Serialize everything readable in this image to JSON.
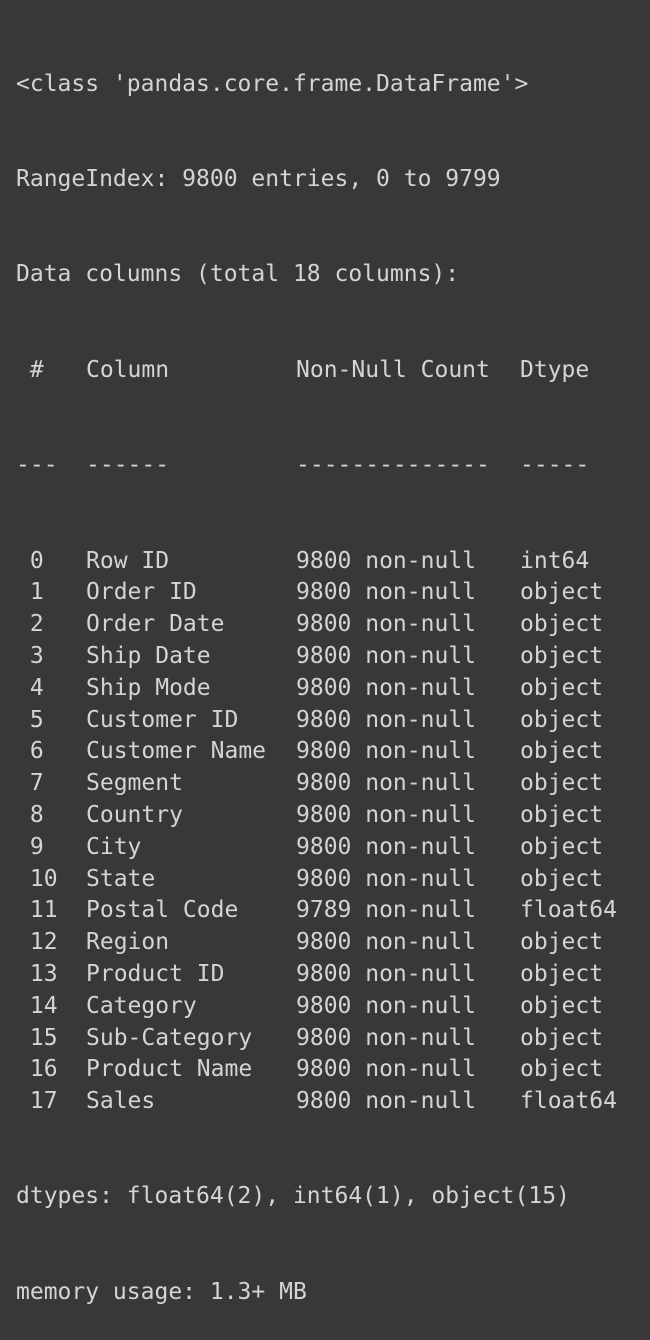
{
  "header": {
    "class_line": "<class 'pandas.core.frame.DataFrame'>",
    "range_index": "RangeIndex: 9800 entries, 0 to 9799",
    "data_columns": "Data columns (total 18 columns):"
  },
  "table": {
    "headers": {
      "idx": " #",
      "column": "Column",
      "non_null": "Non-Null Count",
      "dtype": "Dtype"
    },
    "separators": {
      "idx": "---",
      "column": "------",
      "non_null": "--------------",
      "dtype": "-----"
    },
    "rows": [
      {
        "idx": " 0",
        "column": "Row ID",
        "non_null": "9800 non-null",
        "dtype": "int64"
      },
      {
        "idx": " 1",
        "column": "Order ID",
        "non_null": "9800 non-null",
        "dtype": "object"
      },
      {
        "idx": " 2",
        "column": "Order Date",
        "non_null": "9800 non-null",
        "dtype": "object"
      },
      {
        "idx": " 3",
        "column": "Ship Date",
        "non_null": "9800 non-null",
        "dtype": "object"
      },
      {
        "idx": " 4",
        "column": "Ship Mode",
        "non_null": "9800 non-null",
        "dtype": "object"
      },
      {
        "idx": " 5",
        "column": "Customer ID",
        "non_null": "9800 non-null",
        "dtype": "object"
      },
      {
        "idx": " 6",
        "column": "Customer Name",
        "non_null": "9800 non-null",
        "dtype": "object"
      },
      {
        "idx": " 7",
        "column": "Segment",
        "non_null": "9800 non-null",
        "dtype": "object"
      },
      {
        "idx": " 8",
        "column": "Country",
        "non_null": "9800 non-null",
        "dtype": "object"
      },
      {
        "idx": " 9",
        "column": "City",
        "non_null": "9800 non-null",
        "dtype": "object"
      },
      {
        "idx": " 10",
        "column": "State",
        "non_null": "9800 non-null",
        "dtype": "object"
      },
      {
        "idx": " 11",
        "column": "Postal Code",
        "non_null": "9789 non-null",
        "dtype": "float64"
      },
      {
        "idx": " 12",
        "column": "Region",
        "non_null": "9800 non-null",
        "dtype": "object"
      },
      {
        "idx": " 13",
        "column": "Product ID",
        "non_null": "9800 non-null",
        "dtype": "object"
      },
      {
        "idx": " 14",
        "column": "Category",
        "non_null": "9800 non-null",
        "dtype": "object"
      },
      {
        "idx": " 15",
        "column": "Sub-Category",
        "non_null": "9800 non-null",
        "dtype": "object"
      },
      {
        "idx": " 16",
        "column": "Product Name",
        "non_null": "9800 non-null",
        "dtype": "object"
      },
      {
        "idx": " 17",
        "column": "Sales",
        "non_null": "9800 non-null",
        "dtype": "float64"
      }
    ]
  },
  "footer": {
    "dtypes": "dtypes: float64(2), int64(1), object(15)",
    "memory": "memory usage: 1.3+ MB"
  }
}
